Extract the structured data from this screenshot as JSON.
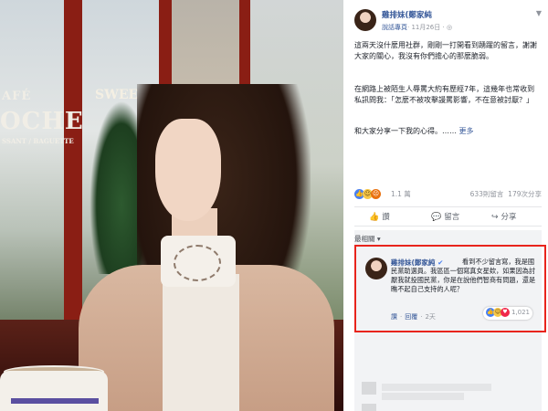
{
  "post": {
    "author": "雞排妹(鄭家純",
    "meta_link": "說話專頁",
    "meta_date": "· 11月26日 · ",
    "menu_icon": "chevron-down-icon",
    "paragraph_1": "這兩天沒什麼用社群，剛剛一打開看到踴躍的留言，謝謝大家的關心，我沒有你們擔心的那麼脆弱。",
    "paragraph_2": "在網路上被陌生人辱罵大約有歷經7年，這幾年也常收到私訊問我：「怎麼不被攻擊謾罵影響，不在意被討厭？」",
    "paragraph_3": "和大家分享一下我的心得。……",
    "more_label": "更多"
  },
  "reactions": {
    "count": "1.1 萬",
    "comments": "633則留言",
    "shares": "179次分享"
  },
  "actions": {
    "like": "讚",
    "comment": "留言",
    "share": "分享"
  },
  "comments": {
    "sort_label": "最相關 ▾",
    "highlighted": {
      "author": "雞排妹(鄭家純",
      "text": "看到不少留言寫，我是國民黨助選員。我區區一個寫真女星欸，如果因為討厭我就投國民黨，你是在說他們智商有問題，還是瞧不起自己支持的人呢？",
      "like_label": "讚",
      "reply_label": "回覆",
      "time": "2天",
      "reaction_count": "1,021"
    }
  },
  "photo": {
    "sign_1": "AFÉ",
    "sign_2": "OCHE",
    "sign_3": "SSANT / BAGUETTE",
    "sign_4": "SWEE"
  },
  "colors": {
    "brand_link": "#365899",
    "highlight_border": "#e8241c",
    "like_blue": "#4a80f0"
  }
}
